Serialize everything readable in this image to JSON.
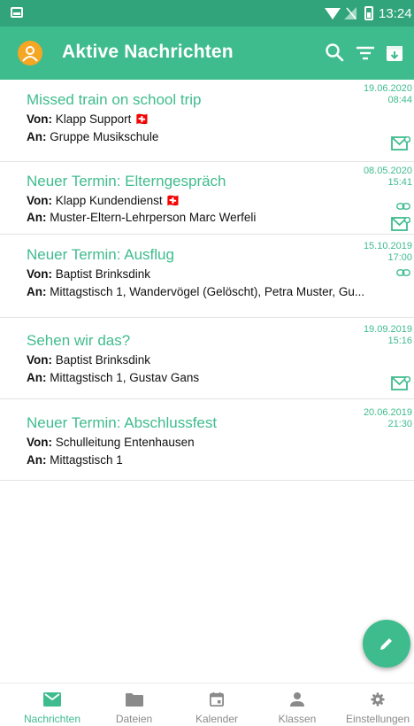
{
  "status_bar": {
    "time": "13:24"
  },
  "app_bar": {
    "title": "Aktive Nachrichten",
    "icons": [
      "user-avatar-icon",
      "search-icon",
      "filter-icon",
      "archive-icon"
    ]
  },
  "colors": {
    "primary": "#3fbc8e",
    "status_bar": "#31a47c",
    "avatar": "#f5a623",
    "subject_text": "#3fbc8e"
  },
  "labels": {
    "from": "Von:",
    "to": "An:"
  },
  "messages": [
    {
      "subject": "Missed train on school trip",
      "from": "Klapp Support 🇨🇭",
      "to": "Gruppe Musikschule",
      "date": "19.06.2020",
      "time": "08:44",
      "has_link": false,
      "has_mail": true
    },
    {
      "subject": "Neuer Termin: Elterngespräch",
      "from": "Klapp Kundendienst 🇨🇭",
      "to": "Muster-Eltern-Lehrperson Marc Werfeli",
      "date": "08.05.2020",
      "time": "15:41",
      "has_link": true,
      "has_mail": true
    },
    {
      "subject": "Neuer Termin: Ausflug",
      "from": "Baptist Brinksdink",
      "to": "Mittagstisch 1, Wandervögel (Gelöscht), Petra Muster, Gu...",
      "date": "15.10.2019",
      "time": "17:00",
      "has_link": true,
      "has_mail": false
    },
    {
      "subject": "Sehen wir das?",
      "from": "Baptist Brinksdink",
      "to": "Mittagstisch 1, Gustav Gans",
      "date": "19.09.2019",
      "time": "15:16",
      "has_link": false,
      "has_mail": true
    },
    {
      "subject": "Neuer Termin: Abschlussfest",
      "from": "Schulleitung Entenhausen",
      "to": "Mittagstisch 1",
      "date": "20.06.2019",
      "time": "21:30",
      "has_link": false,
      "has_mail": false
    }
  ],
  "bottom_nav": [
    {
      "label": "Nachrichten",
      "icon": "mail-icon",
      "active": true
    },
    {
      "label": "Dateien",
      "icon": "folder-icon",
      "active": false
    },
    {
      "label": "Kalender",
      "icon": "calendar-icon",
      "active": false
    },
    {
      "label": "Klassen",
      "icon": "person-icon",
      "active": false
    },
    {
      "label": "Einstellungen",
      "icon": "gear-icon",
      "active": false
    }
  ]
}
